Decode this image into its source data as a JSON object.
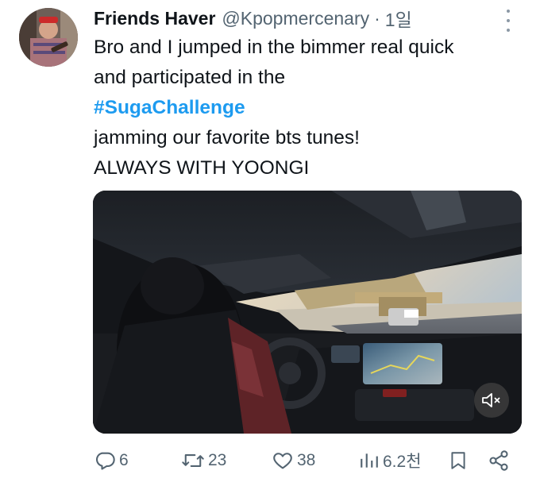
{
  "tweet": {
    "display_name": "Friends Haver",
    "handle": "@Kpopmercenary",
    "separator": "·",
    "time": "1일",
    "lines": [
      "Bro and I jumped in the bimmer real quick",
      "and participated in the",
      "jamming our favorite bts tunes!",
      "ALWAYS WITH YOONGI"
    ],
    "hashtag": "#SugaChallenge"
  },
  "media": {
    "type": "video",
    "muted": true
  },
  "actions": {
    "replies": "6",
    "reposts": "23",
    "likes": "38",
    "views": "6.2천"
  },
  "colors": {
    "text": "#0f1419",
    "secondary": "#536471",
    "link": "#1d9bf0"
  },
  "icons": [
    "more-icon",
    "reply-icon",
    "repost-icon",
    "like-icon",
    "views-icon",
    "bookmark-icon",
    "share-icon",
    "mute-icon"
  ]
}
